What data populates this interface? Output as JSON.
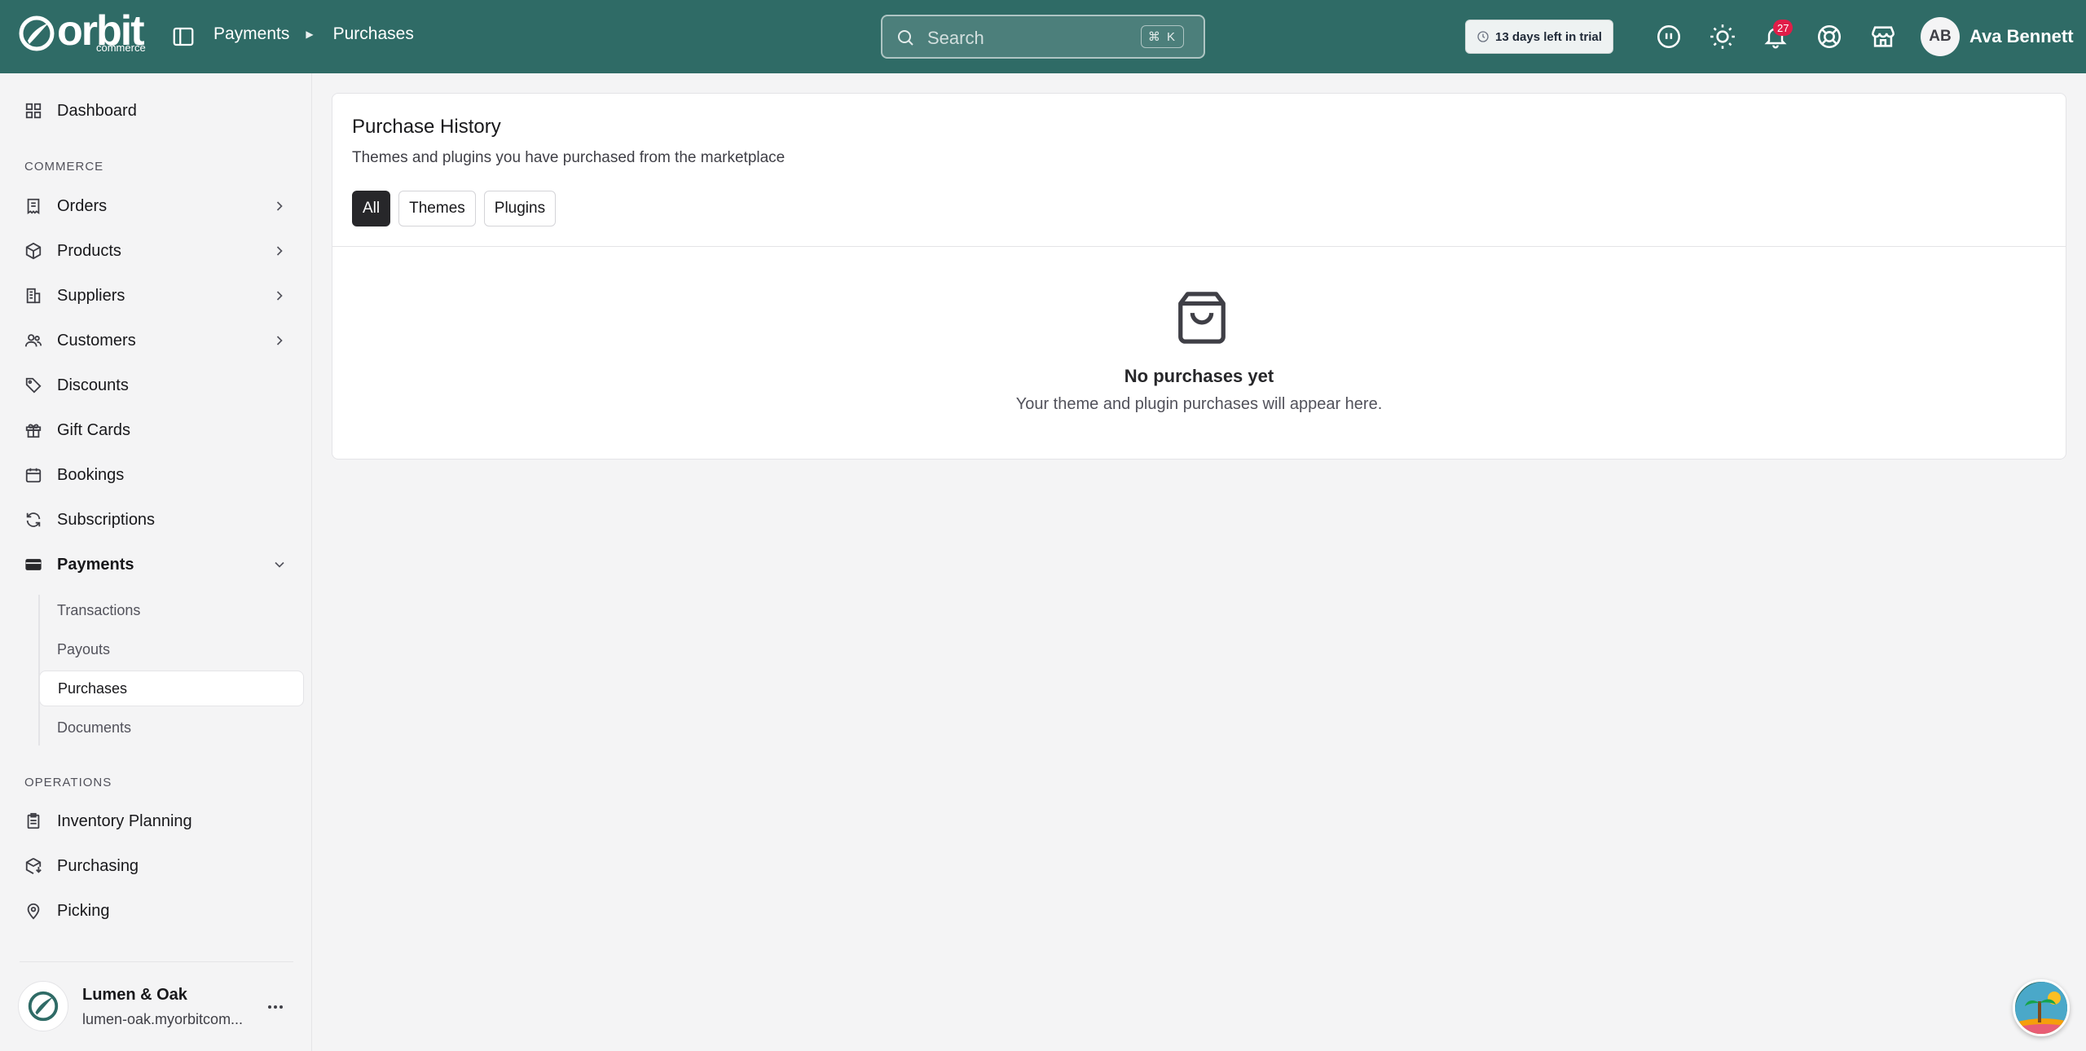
{
  "header": {
    "logo_word": "orbit",
    "logo_sub": "commerce",
    "breadcrumb": [
      "Payments",
      "Purchases"
    ],
    "search_placeholder": "Search",
    "search_shortcut": "⌘ K",
    "trial_text": "13 days left in trial",
    "notification_count": "27",
    "user_initials": "AB",
    "user_name": "Ava Bennett"
  },
  "sidebar": {
    "dashboard": "Dashboard",
    "section_commerce": "COMMERCE",
    "orders": "Orders",
    "products": "Products",
    "suppliers": "Suppliers",
    "customers": "Customers",
    "discounts": "Discounts",
    "gift_cards": "Gift Cards",
    "bookings": "Bookings",
    "subscriptions": "Subscriptions",
    "payments": "Payments",
    "payments_sub": [
      "Transactions",
      "Payouts",
      "Purchases",
      "Documents"
    ],
    "section_operations": "OPERATIONS",
    "inventory_planning": "Inventory Planning",
    "purchasing": "Purchasing",
    "picking": "Picking",
    "store_name": "Lumen & Oak",
    "store_url": "lumen-oak.myorbitcom..."
  },
  "main": {
    "title": "Purchase History",
    "subtitle": "Themes and plugins you have purchased from the marketplace",
    "tabs": [
      "All",
      "Themes",
      "Plugins"
    ],
    "empty_title": "No purchases yet",
    "empty_sub": "Your theme and plugin purchases will appear here."
  },
  "colors": {
    "header_bg": "#2f6b66",
    "active_tab_bg": "#27272a",
    "badge": "#e11d48"
  }
}
